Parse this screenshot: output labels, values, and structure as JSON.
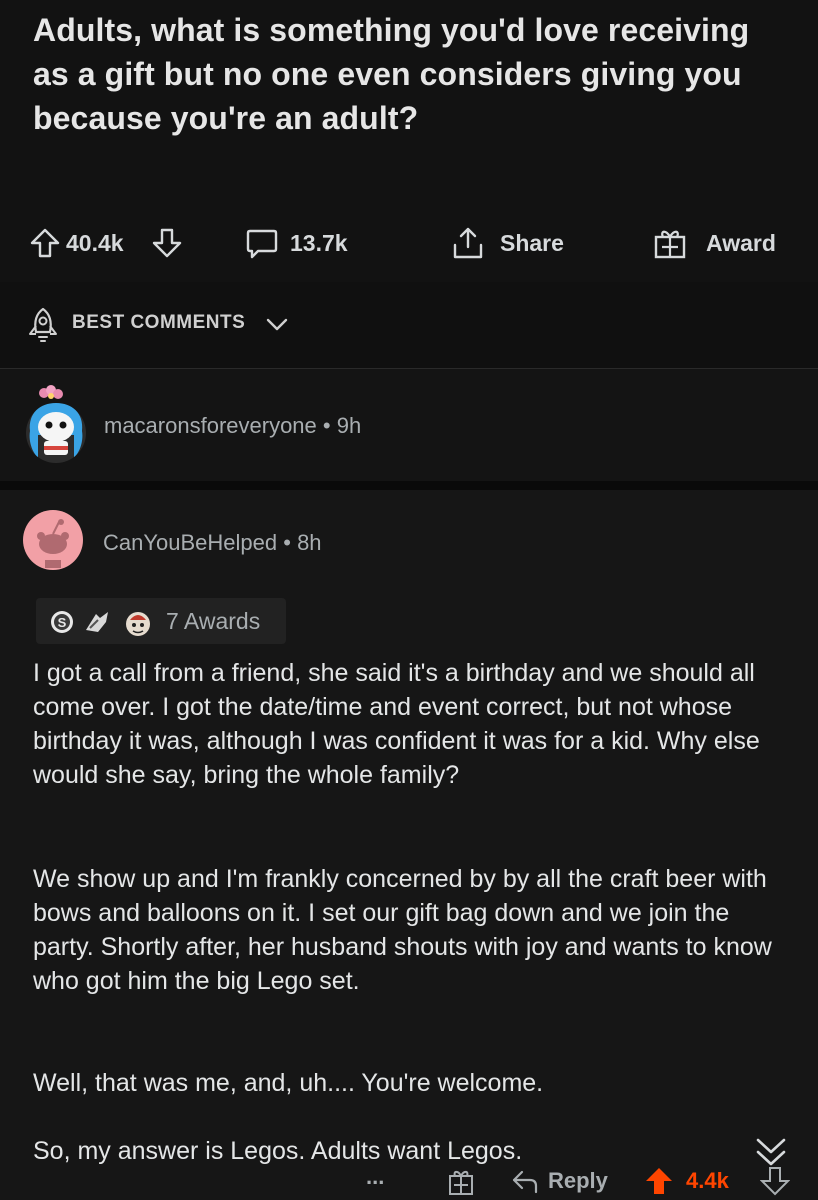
{
  "post": {
    "title": "Adults, what is something you'd love receiving as a gift but no one even considers giving you because you're an adult?",
    "upvotes": "40.4k",
    "comments": "13.7k",
    "share_label": "Share",
    "award_label": "Award"
  },
  "sort": {
    "label": "BEST COMMENTS"
  },
  "comments": [
    {
      "username": "macaronsforeveryone",
      "time": "9h"
    },
    {
      "username": "CanYouBeHelped",
      "time": "8h",
      "awards_label": "7 Awards",
      "paragraphs": [
        "I got a call from a friend, she said it's a birthday and we should all come over. I got the date/time and event correct, but not whose birthday it was, although I was confident it was for a kid. Why else would she say, bring the whole family?",
        "We show up and I'm frankly concerned by by all the craft beer with bows and balloons on it. I set our gift bag down and we join the party. Shortly after, her husband shouts with joy and wants to know who got him the big Lego set.",
        "Well, that was me, and, uh.... You're welcome.",
        "So, my answer is Legos. Adults want Legos."
      ],
      "more_label": "...",
      "reply_label": "Reply",
      "score": "4.4k"
    }
  ],
  "colors": {
    "upvote_active": "#ff4500",
    "background": "#0d0d0d",
    "text": "#e4e6e7",
    "meta": "#a9aeb1"
  },
  "icons": [
    "upvote-icon",
    "downvote-icon",
    "comment-icon",
    "share-icon",
    "award-icon",
    "rocket-icon",
    "chevron-down-icon",
    "snoo-avatar-icon",
    "collapse-icon",
    "more-icon",
    "reply-icon"
  ]
}
